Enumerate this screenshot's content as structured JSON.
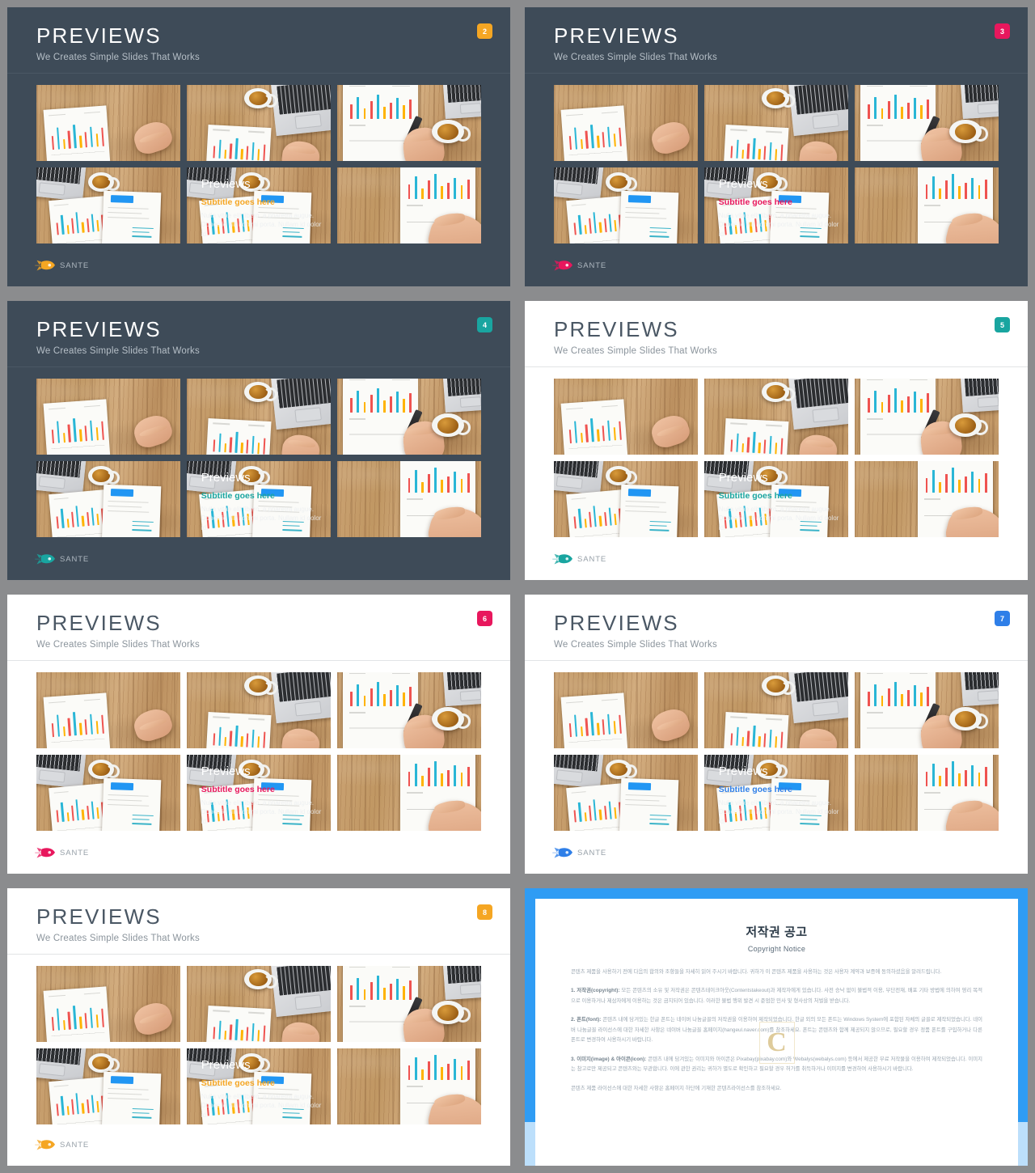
{
  "brand": {
    "name": "SANTE",
    "icon": "rocket-icon"
  },
  "header": {
    "title": "PREVIEWS",
    "subtitle": "We Creates Simple Slides That Works"
  },
  "overlay": {
    "title": "Previews",
    "subtitle": "Subtitle goes here",
    "body_line1": "Nulla vitae elit libero, a pharetra augue.",
    "body_line2": "Donec id elit non mi porta. Nullam id dolor id."
  },
  "slides": [
    {
      "number": "2",
      "theme": "dark",
      "accent": "#f5a623",
      "badge_color": "#f5a623",
      "rocket_color": "#f5a623",
      "title": "PREVIEWS",
      "subtitle": "We Creates Simple Slides That Works",
      "overlay_subtitle_color": "#f5a623"
    },
    {
      "number": "3",
      "theme": "dark",
      "accent": "#e8175d",
      "badge_color": "#e8175d",
      "rocket_color": "#e8175d",
      "title": "PREVIEWS",
      "subtitle": "We Creates Simple Slides That Works",
      "overlay_subtitle_color": "#e8175d"
    },
    {
      "number": "4",
      "theme": "dark",
      "accent": "#19a5a0",
      "badge_color": "#19a5a0",
      "rocket_color": "#19a5a0",
      "title": "PREVIEWS",
      "subtitle": "We Creates Simple Slides That Works",
      "overlay_subtitle_color": "#19a5a0"
    },
    {
      "number": "5",
      "theme": "light",
      "accent": "#19a5a0",
      "badge_color": "#19a5a0",
      "rocket_color": "#19a5a0",
      "title": "PREVIEWS",
      "subtitle": "We Creates Simple Slides That Works",
      "overlay_subtitle_color": "#19a5a0"
    },
    {
      "number": "6",
      "theme": "light",
      "accent": "#e8175d",
      "badge_color": "#e8175d",
      "rocket_color": "#e8175d",
      "title": "PREVIEWS",
      "subtitle": "We Creates Simple Slides That Works",
      "overlay_subtitle_color": "#e8175d"
    },
    {
      "number": "7",
      "theme": "light",
      "accent": "#2f7fe8",
      "badge_color": "#2f7fe8",
      "rocket_color": "#2f7fe8",
      "title": "PREVIEWS",
      "subtitle": "We Creates Simple Slides That Works",
      "overlay_subtitle_color": "#2f7fe8"
    },
    {
      "number": "8",
      "theme": "light",
      "accent": "#f5a623",
      "badge_color": "#f5a623",
      "rocket_color": "#f5a623",
      "title": "PREVIEWS",
      "subtitle": "We Creates Simple Slides That Works",
      "overlay_subtitle_color": "#f5a623"
    }
  ],
  "copyright": {
    "heading_ko": "저작권 공고",
    "heading_en": "Copyright Notice",
    "watermark": "C",
    "frame_color": "#2f9cf4",
    "paragraphs": [
      "콘텐츠 제품을 사용하기 전에 다음의 합의와 조항들을 자세히 읽어 주시기 바랍니다. 귀하가 이 콘텐츠 제품을 사용하는 것은 사용자 계약과 보증에 동의하셨음을 알려드립니다.",
      "1. 저작권(copyright): 모든 콘텐츠의 소유 및 저작권은 콘텐츠테이크아웃(Contentstakeout)과 제작자에게 있습니다. 사전 승낙 없이 불법적 이용, 무단전재, 배포 기타 방법에 의하여 영리 목적으로 이용하거나 제삼자에게 이용하는 것은 금지되어 있습니다. 이러한 불법 행위 발견 시 준엄한 민사 및 형사상의 처벌을 받습니다.",
      "2. 폰트(font): 콘텐츠 내에 담겨있는 한글 폰트는 네이버 나눔글꼴의 저작권을 이용하여 제작되었습니다. 한글 외의 모든 폰트는 Windows System에 포함된 자체의 글꼴로 제작되었습니다. 네이버 나눔글꼴 라이선스에 대한 자세한 사항은 네이버 나눔글꼴 홈페이지(hangeul.naver.com)를 참조하세요. 폰트는 콘텐츠와 함께 제공되지 않으므로, 필요할 경우 정품 폰트를 구입하거나 다른 폰트로 변경하여 사용하시기 바랍니다.",
      "3. 이미지(image) & 아이콘(icon): 콘텐츠 내에 담겨있는 이미지와 아이콘은 Pixabay(pixabay.com)와 Webalys(webalys.com) 등에서 제공한 무료 저작물을 이용하여 제작되었습니다. 이미지는 참고로만 제공되고 콘텐츠와는 무관합니다. 이에 관한 권리는 귀하가 별도로 확인하고 필요할 경우 허가를 취득하거나 이미지를 변경하여 사용하시기 바랍니다.",
      "콘텐츠 제품 라이선스에 대한 자세한 사항은 홈페이지 하단에 기재한 콘텐츠라이선스를 참조하세요."
    ]
  }
}
